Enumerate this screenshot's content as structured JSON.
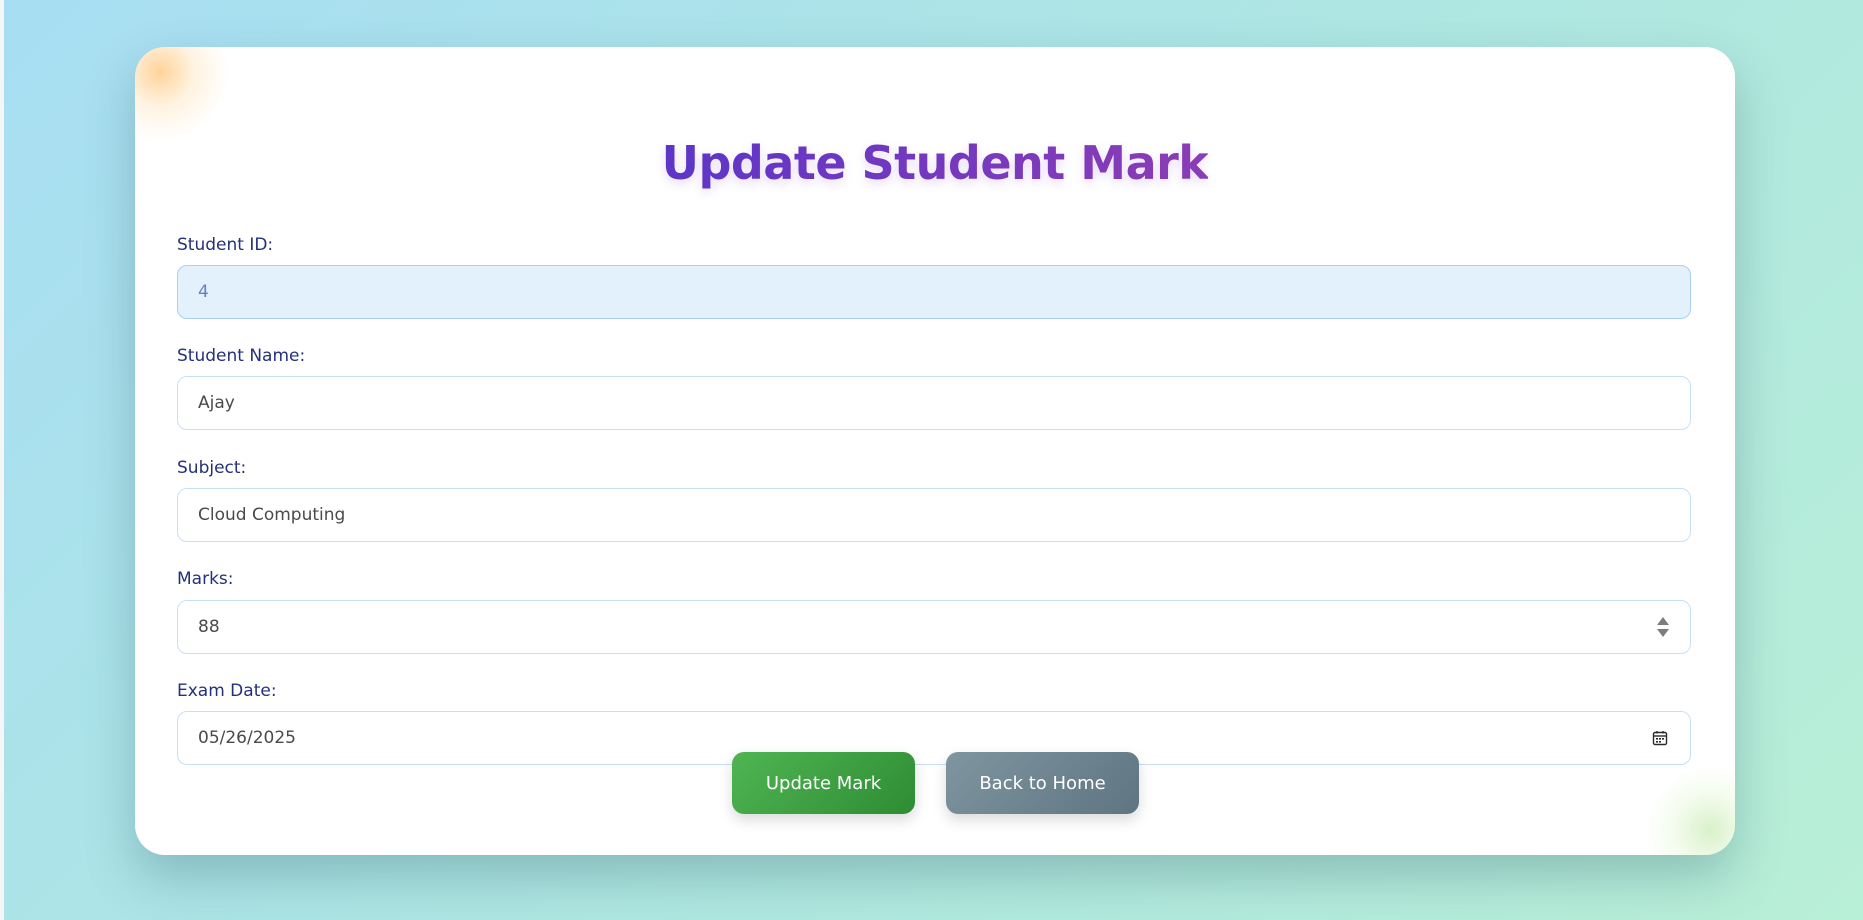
{
  "page": {
    "title": "Update Student Mark"
  },
  "form": {
    "student_id": {
      "label": "Student ID:",
      "value": "4"
    },
    "student_name": {
      "label": "Student Name:",
      "value": "Ajay"
    },
    "subject": {
      "label": "Subject:",
      "value": "Cloud Computing"
    },
    "marks": {
      "label": "Marks:",
      "value": "88"
    },
    "exam_date": {
      "label": "Exam Date:",
      "value": "05/26/2025"
    }
  },
  "actions": {
    "update_label": "Update Mark",
    "home_label": "Back to Home"
  },
  "icons": {
    "marks_spinner": "stepper-arrows-icon",
    "date_picker": "calendar-icon"
  },
  "colors": {
    "title_gradient_start": "#5b36c8",
    "title_gradient_end": "#8e3db3",
    "label_color": "#24307a",
    "update_button": "#3fa044",
    "home_button": "#6d838f",
    "readonly_field_bg": "#e3f1fc"
  }
}
